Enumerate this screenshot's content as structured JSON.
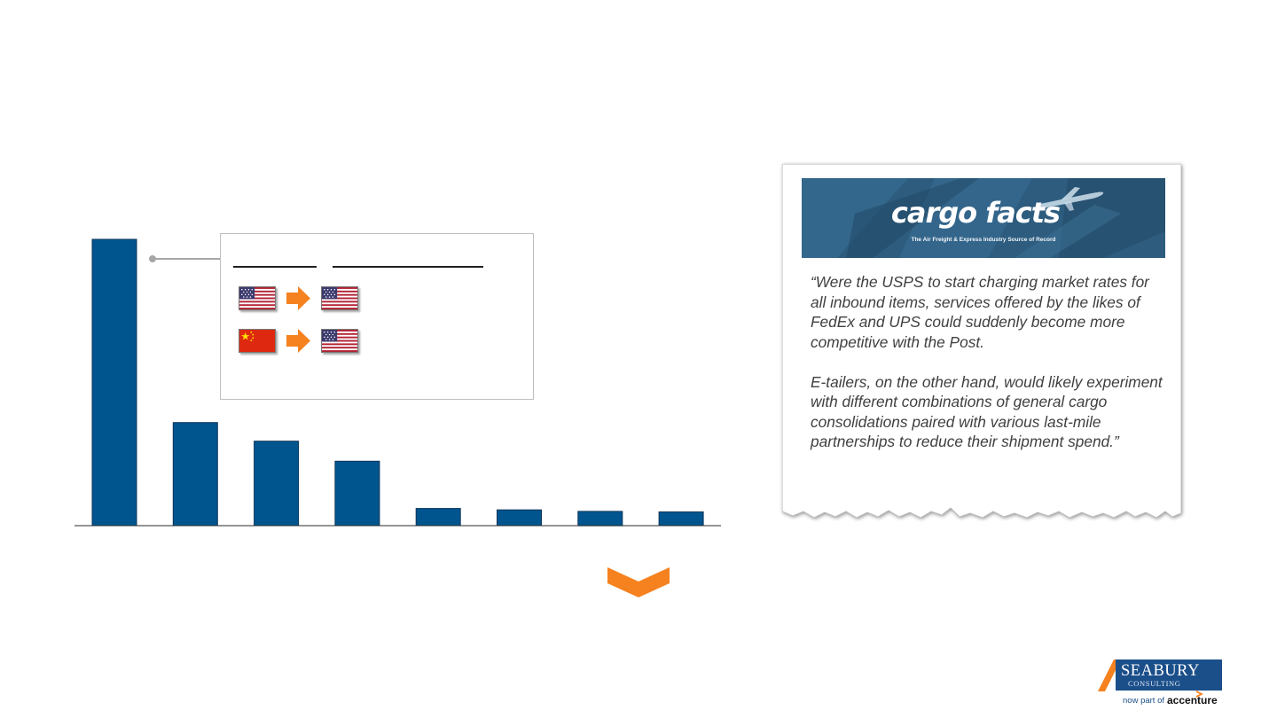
{
  "chart_data": {
    "type": "bar",
    "categories": [
      "",
      "",
      "",
      "",
      "",
      "",
      "",
      ""
    ],
    "values": [
      100,
      36,
      29.5,
      22.5,
      6,
      5.5,
      5,
      4.8
    ],
    "ylim": [
      0,
      100
    ],
    "grid": false,
    "legend": "none",
    "bar_color": "#00558f"
  },
  "inset": {
    "routes": [
      {
        "from_flag": "us-flag",
        "to_flag": "us-flag"
      },
      {
        "from_flag": "china-flag",
        "to_flag": "us-flag"
      }
    ],
    "arrow_color": "#f5821f"
  },
  "card": {
    "logo_text": "cargo facts",
    "tagline": "The Air Freight & Express Industry Source of Record",
    "paragraphs": [
      "“Were the USPS to start charging market rates for all inbound items, services offered by the likes of FedEx and UPS could suddenly become more competitive with the Post.",
      "E-tailers, on the other hand, would likely experiment with different combinations of general cargo consolidations paired with various last-mile partnerships to reduce their shipment spend.”"
    ]
  },
  "footer_logo": {
    "brand": "SEABURY",
    "sub": "CONSULTING",
    "part_of": "now part of",
    "partner": "accenture",
    "brand_color": "#1b4f8a",
    "accent_color": "#f5821f"
  }
}
